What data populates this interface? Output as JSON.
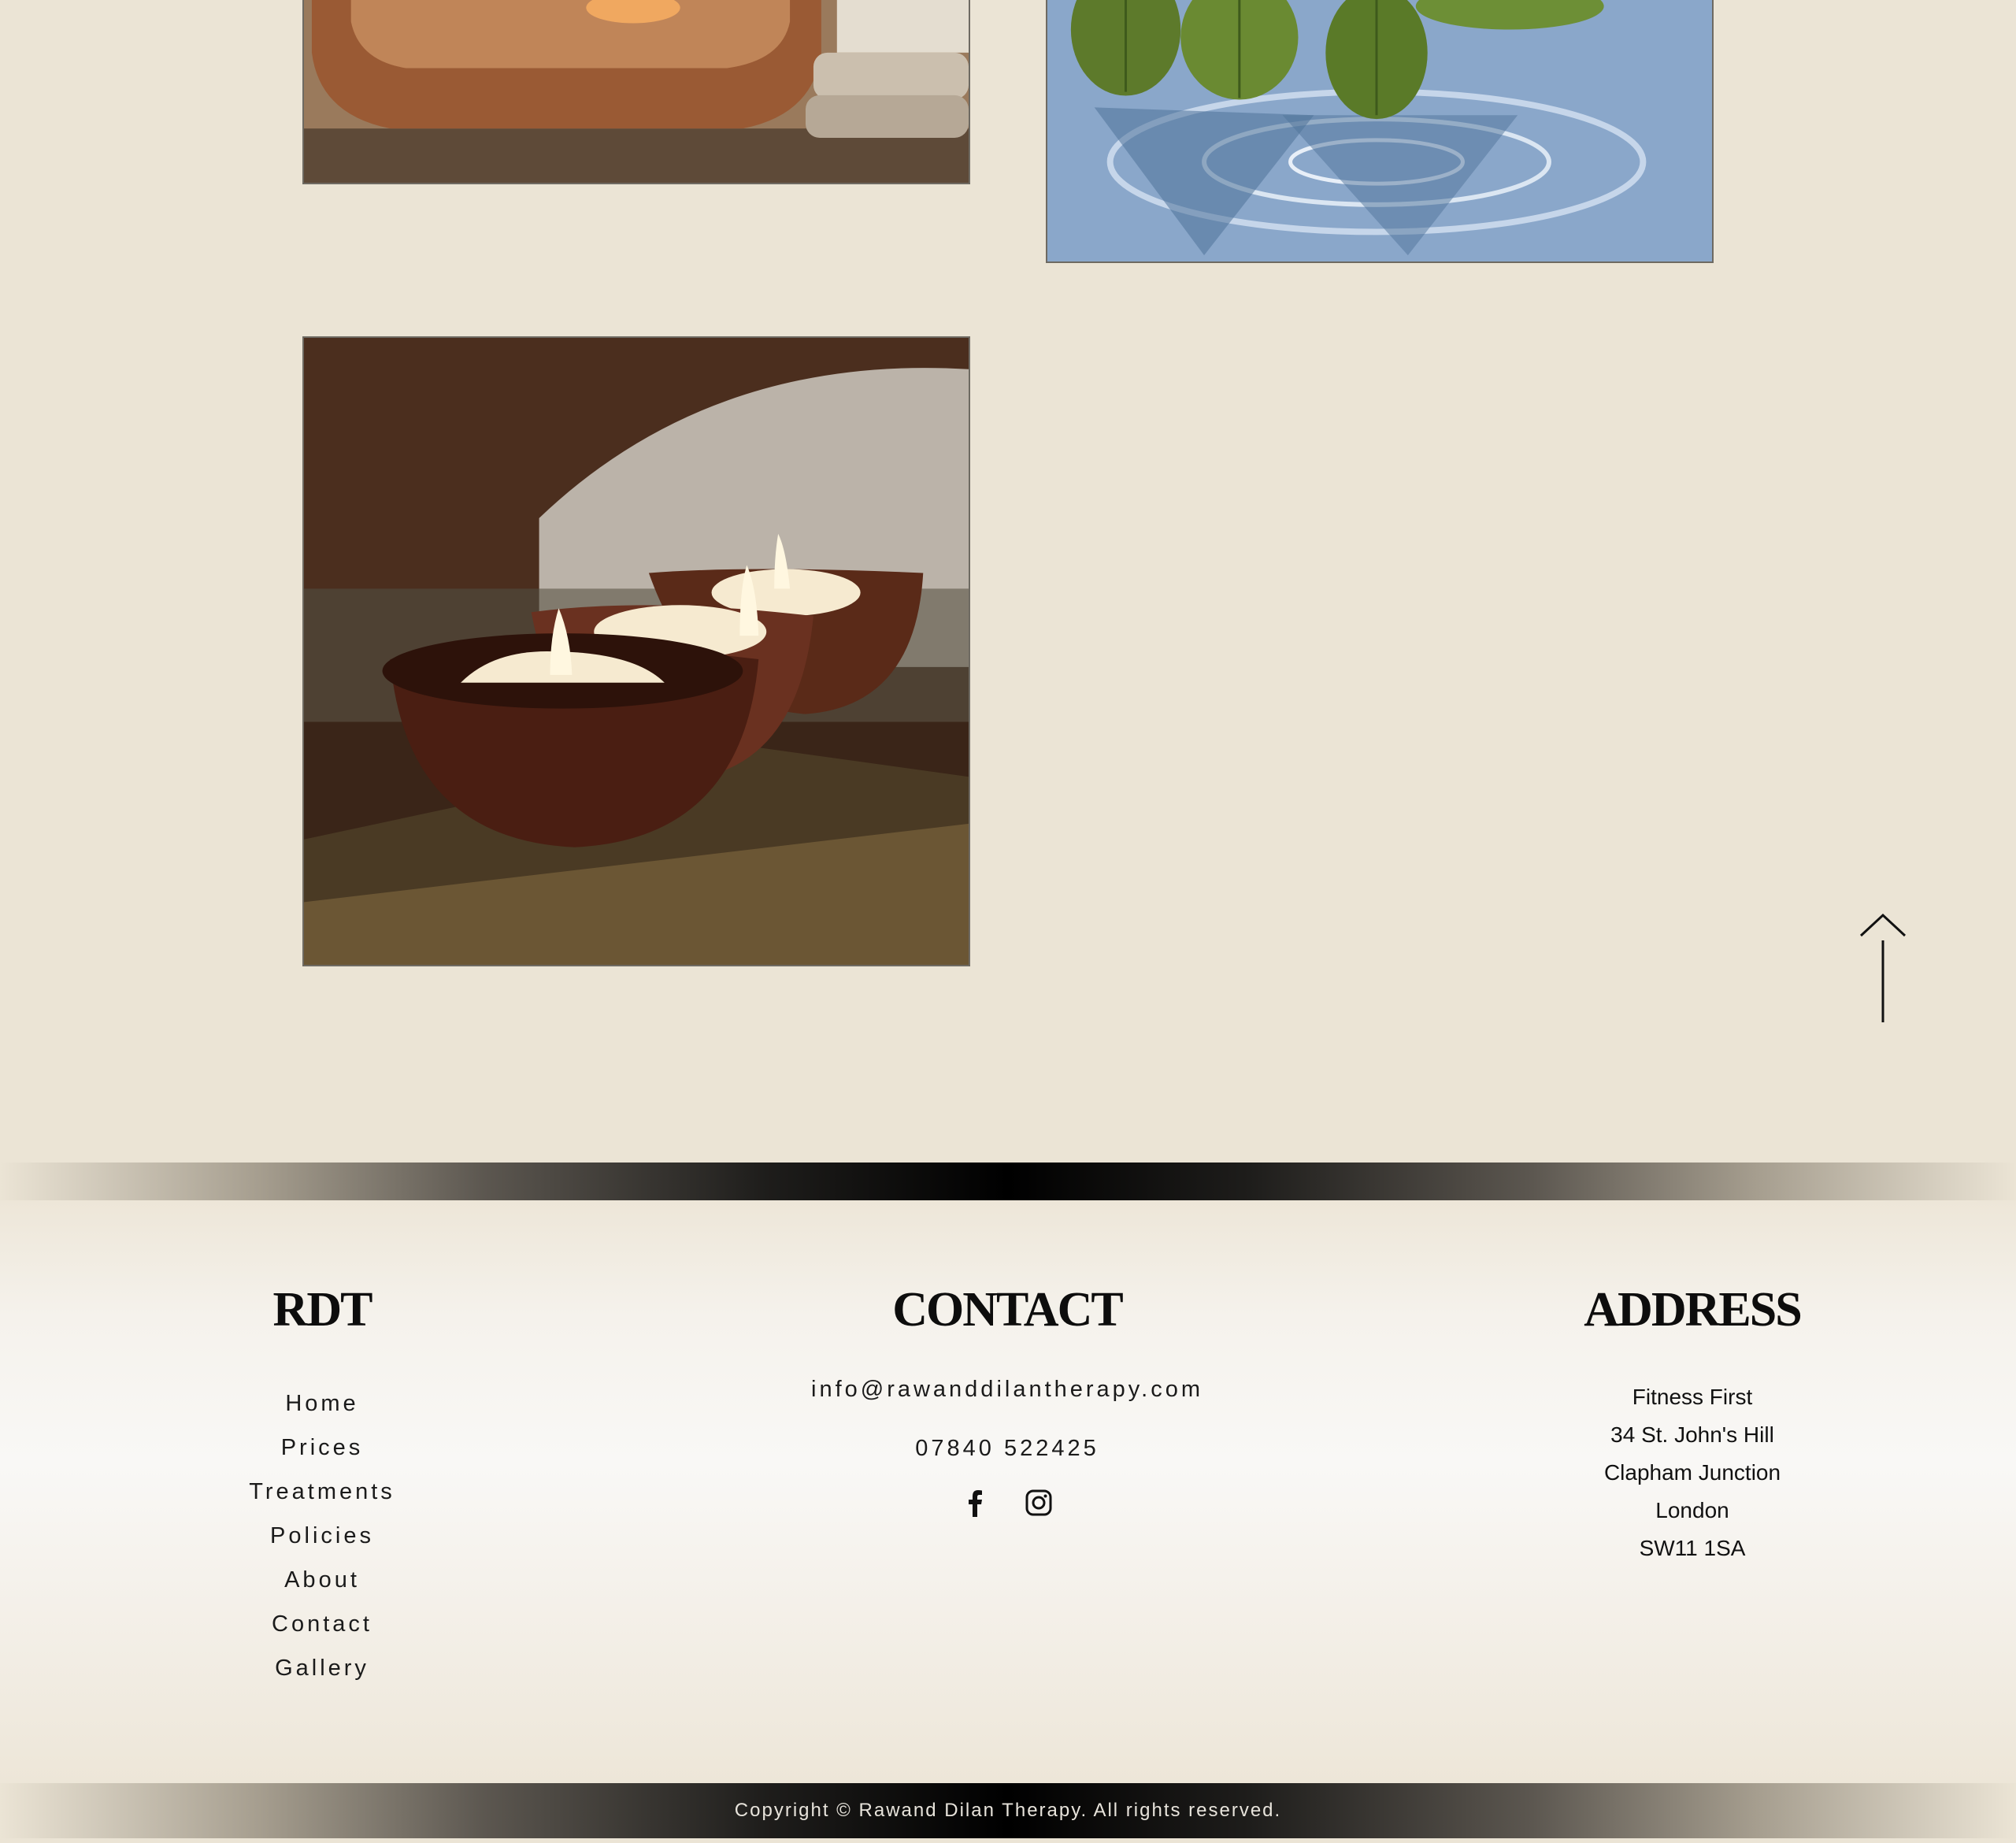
{
  "gallery": {
    "photos": [
      {
        "name": "spa-bowl-photo"
      },
      {
        "name": "leaves-water-photo"
      },
      {
        "name": "candles-photo"
      }
    ]
  },
  "back_to_top": {
    "icon": "arrow-up-icon"
  },
  "footer": {
    "brand": {
      "title": "RDT",
      "nav": [
        "Home",
        "Prices",
        "Treatments",
        "Policies",
        "About",
        "Contact",
        "Gallery"
      ]
    },
    "contact": {
      "title": "CONTACT",
      "email": "info@rawanddilantherapy.com",
      "phone": "07840 522425",
      "social_icons": [
        "facebook-icon",
        "instagram-icon"
      ]
    },
    "address": {
      "title": "ADDRESS",
      "lines": [
        "Fitness First",
        "34 St. John's Hill",
        "Clapham Junction",
        "London",
        "SW11 1SA"
      ]
    },
    "copyright": "Copyright © Rawand Dilan Therapy. All rights reserved."
  },
  "colors": {
    "page_background": "#ebe4d5",
    "band_center": "#000000",
    "text": "#111111"
  }
}
